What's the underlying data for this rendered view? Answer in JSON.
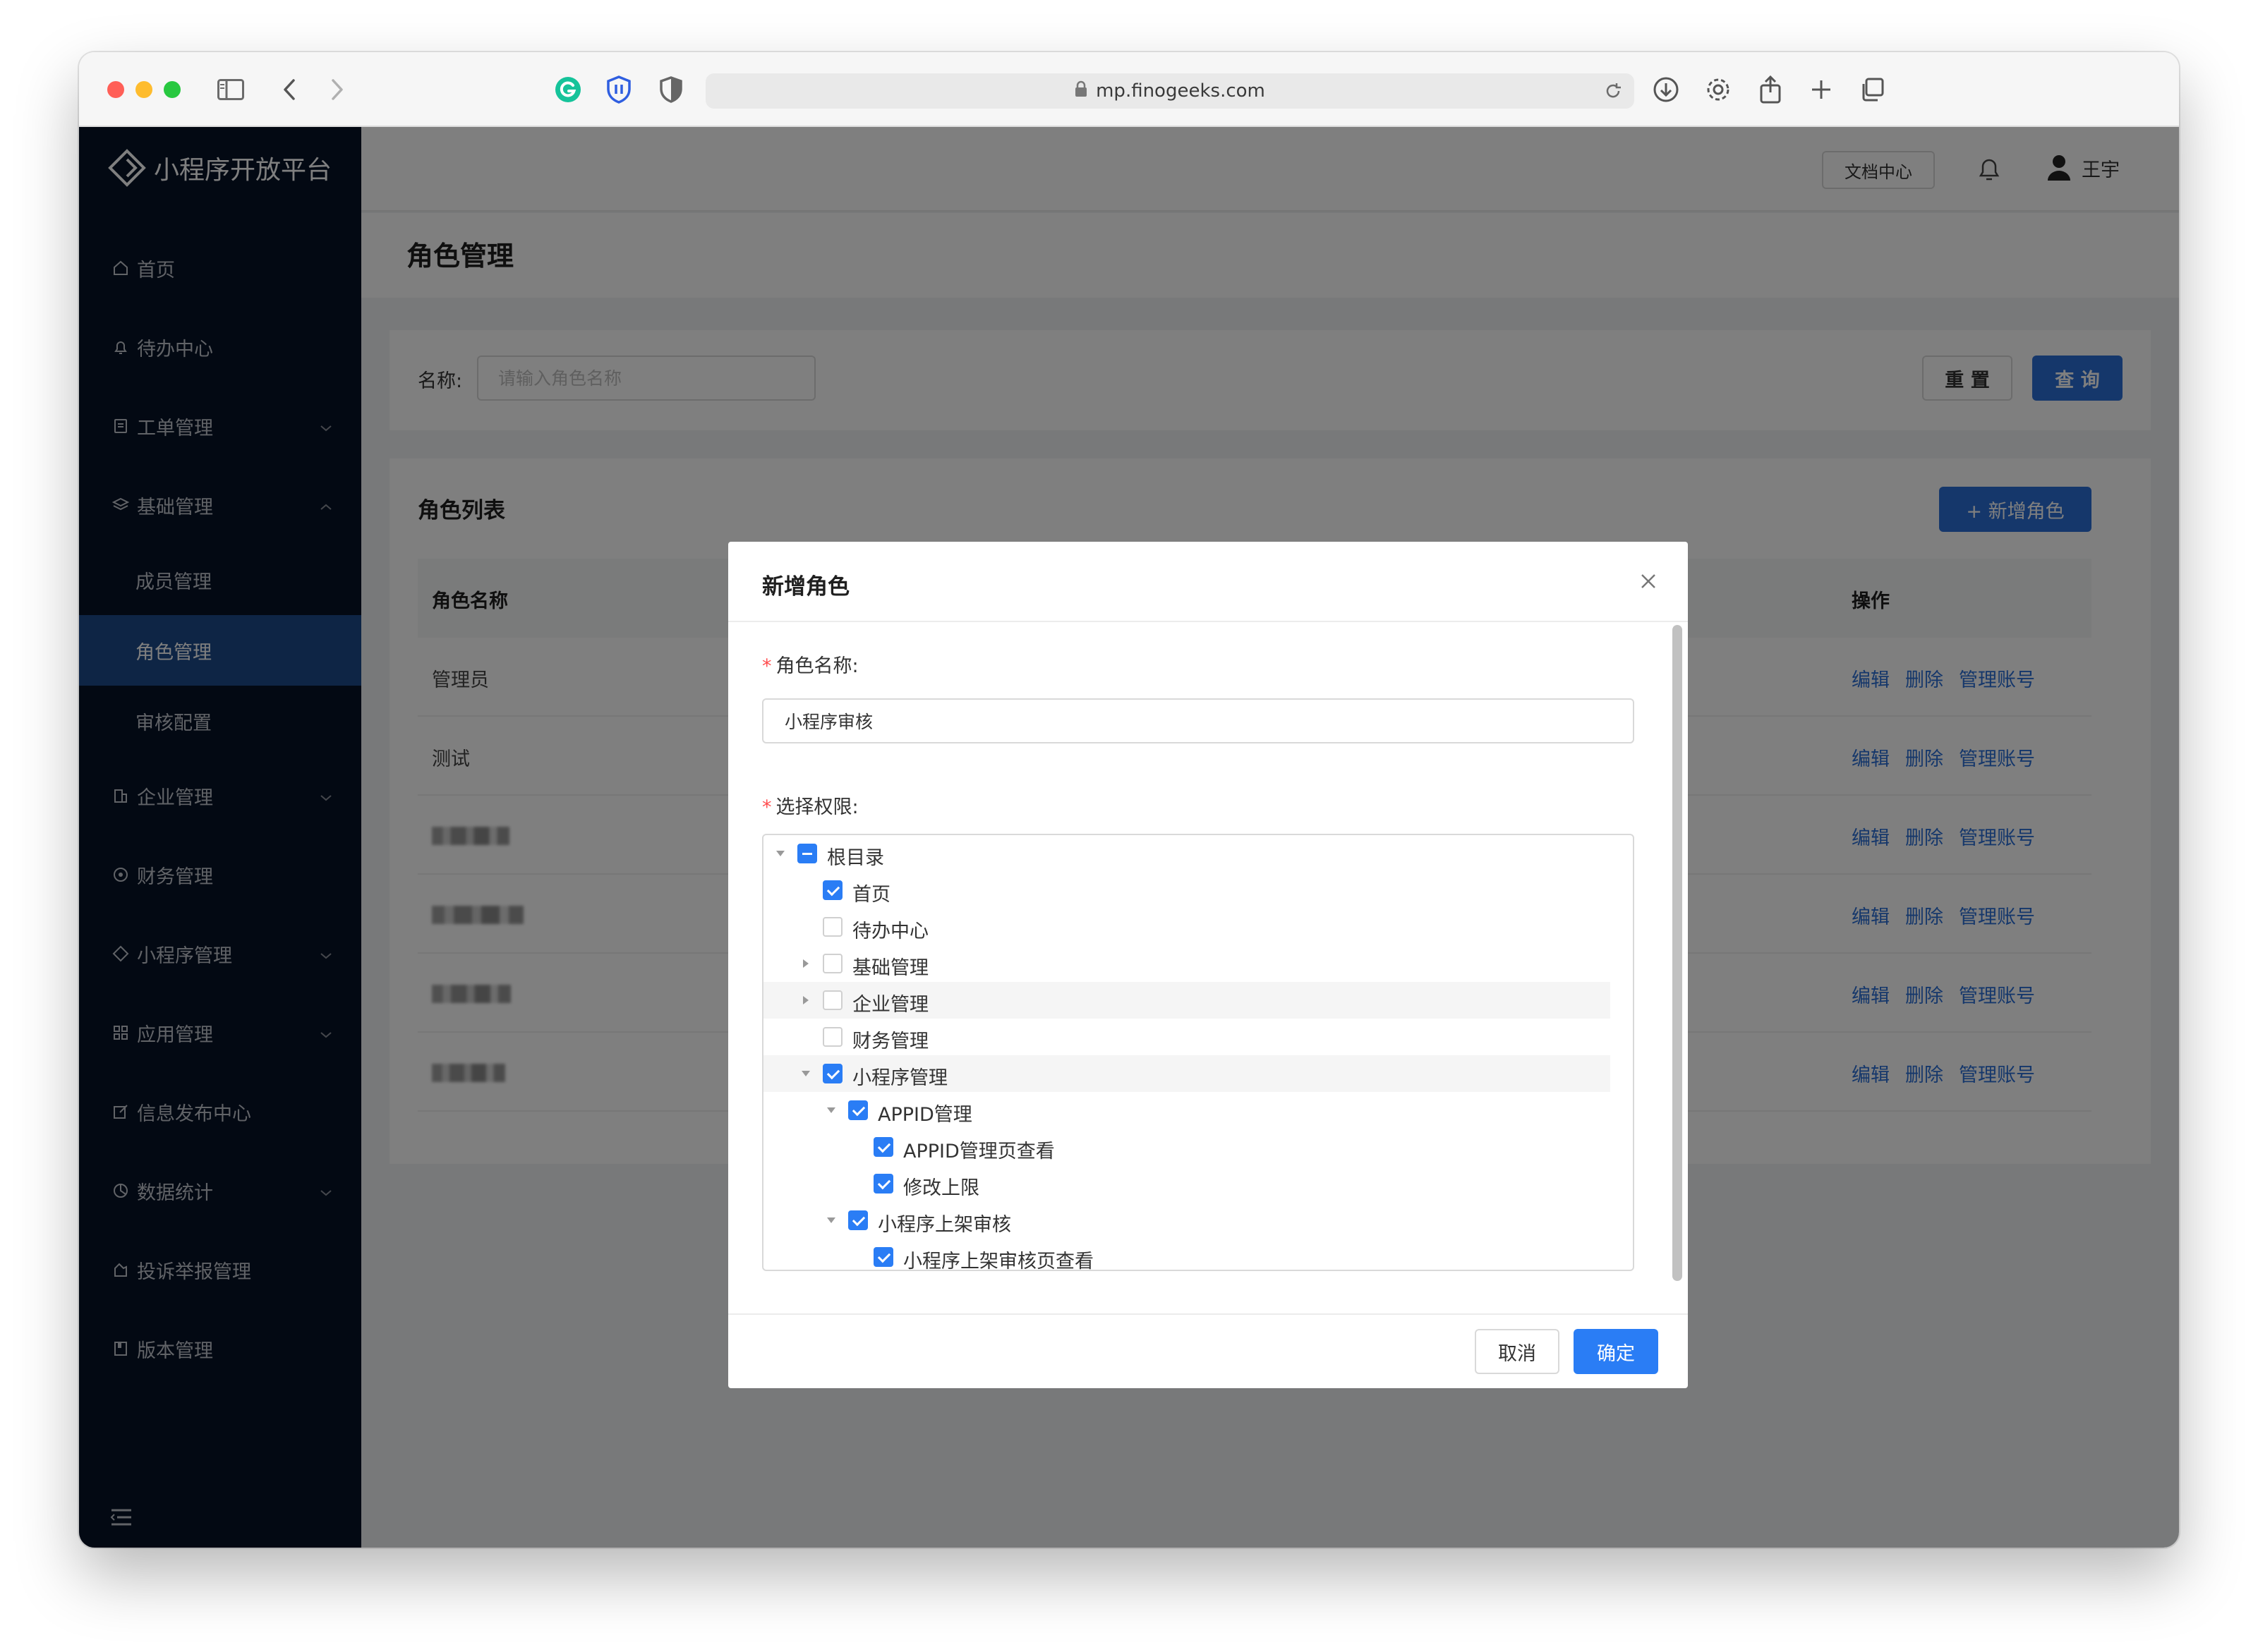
{
  "browser": {
    "url": "mp.finogeeks.com"
  },
  "sidebar": {
    "brand": "小程序开放平台",
    "items": [
      {
        "label": "首页",
        "icon": "home-icon"
      },
      {
        "label": "待办中心",
        "icon": "bell-icon"
      },
      {
        "label": "工单管理",
        "icon": "document-icon"
      },
      {
        "label": "基础管理",
        "icon": "layers-icon"
      },
      {
        "label": "成员管理"
      },
      {
        "label": "角色管理"
      },
      {
        "label": "审核配置"
      },
      {
        "label": "企业管理",
        "icon": "building-icon"
      },
      {
        "label": "财务管理",
        "icon": "coin-icon"
      },
      {
        "label": "小程序管理",
        "icon": "diamond-icon"
      },
      {
        "label": "应用管理",
        "icon": "grid-icon"
      },
      {
        "label": "信息发布中心",
        "icon": "edit-icon"
      },
      {
        "label": "数据统计",
        "icon": "pie-icon"
      },
      {
        "label": "投诉举报管理",
        "icon": "flag-icon"
      },
      {
        "label": "版本管理",
        "icon": "book-icon"
      }
    ]
  },
  "topbar": {
    "doc_center": "文档中心",
    "user_name": "王宇"
  },
  "page": {
    "title": "角色管理"
  },
  "search": {
    "label": "名称:",
    "placeholder": "请输入角色名称",
    "reset": "重 置",
    "query": "查 询"
  },
  "list": {
    "title": "角色列表",
    "add_button": "+ 新增角色",
    "col_name": "角色名称",
    "col_ops": "操作",
    "rows": [
      {
        "name": "管理员"
      },
      {
        "name": "测试"
      }
    ],
    "op_edit": "编辑",
    "op_delete": "删除",
    "op_manage": "管理账号"
  },
  "modal": {
    "title": "新增角色",
    "name_label": "角色名称:",
    "name_value": "小程序审核",
    "perm_label": "选择权限:",
    "tree": [
      "根目录",
      "首页",
      "待办中心",
      "基础管理",
      "企业管理",
      "财务管理",
      "小程序管理",
      "APPID管理",
      "APPID管理页查看",
      "修改上限",
      "小程序上架审核",
      "小程序上架审核页查看"
    ],
    "cancel": "取消",
    "ok": "确定"
  },
  "colors": {
    "sidebar_bg": "#061227",
    "sidebar_active": "#1d4a8a",
    "primary": "#2a6fd6",
    "checkbox": "#2a7df5"
  }
}
